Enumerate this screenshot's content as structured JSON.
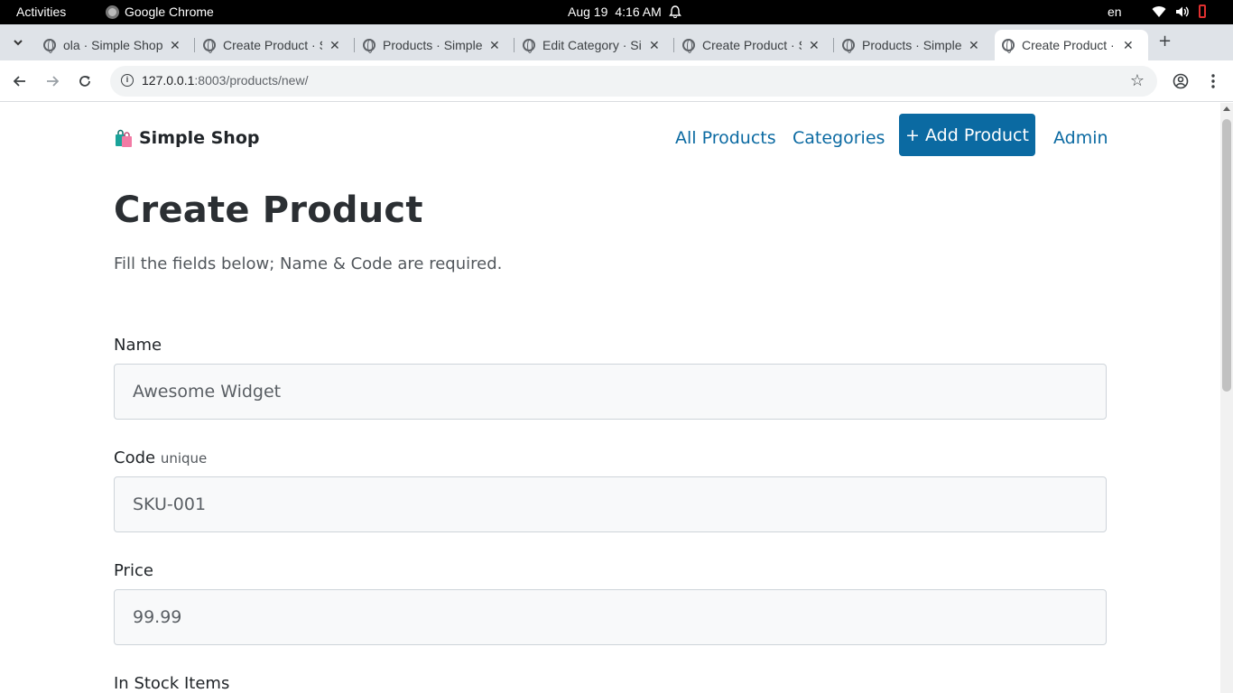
{
  "os": {
    "activities": "Activities",
    "app_name": "Google Chrome",
    "date": "Aug 19",
    "time": "4:16 AM",
    "lang": "en"
  },
  "tabs": [
    {
      "title": "ola · Simple Shop",
      "active": false
    },
    {
      "title": "Create Product · Simple Shop",
      "active": false
    },
    {
      "title": "Products · Simple Shop",
      "active": false
    },
    {
      "title": "Edit Category · Simple Shop",
      "active": false
    },
    {
      "title": "Create Product · Simple Shop",
      "active": false
    },
    {
      "title": "Products · Simple Shop",
      "active": false
    },
    {
      "title": "Create Product · Simple Shop",
      "active": true
    }
  ],
  "omnibox": {
    "host": "127.0.0.1",
    "rest": ":8003/products/new/"
  },
  "navbar": {
    "brand": "Simple Shop",
    "links": {
      "all_products": "All Products",
      "categories": "Categories",
      "add_product": "+ Add Product",
      "admin": "Admin"
    }
  },
  "page": {
    "title": "Create Product",
    "subtitle": "Fill the fields below; Name & Code are required."
  },
  "form": {
    "name": {
      "label": "Name",
      "placeholder": "Awesome Widget"
    },
    "code": {
      "label": "Code",
      "hint": "unique",
      "placeholder": "SKU-001"
    },
    "price": {
      "label": "Price",
      "placeholder": "99.99"
    },
    "stock": {
      "label": "In Stock Items"
    }
  },
  "colors": {
    "accent": "#0b6aa2",
    "title": "#2b2f33",
    "field_bg": "#f8f9fa",
    "field_border": "#ced4da"
  }
}
